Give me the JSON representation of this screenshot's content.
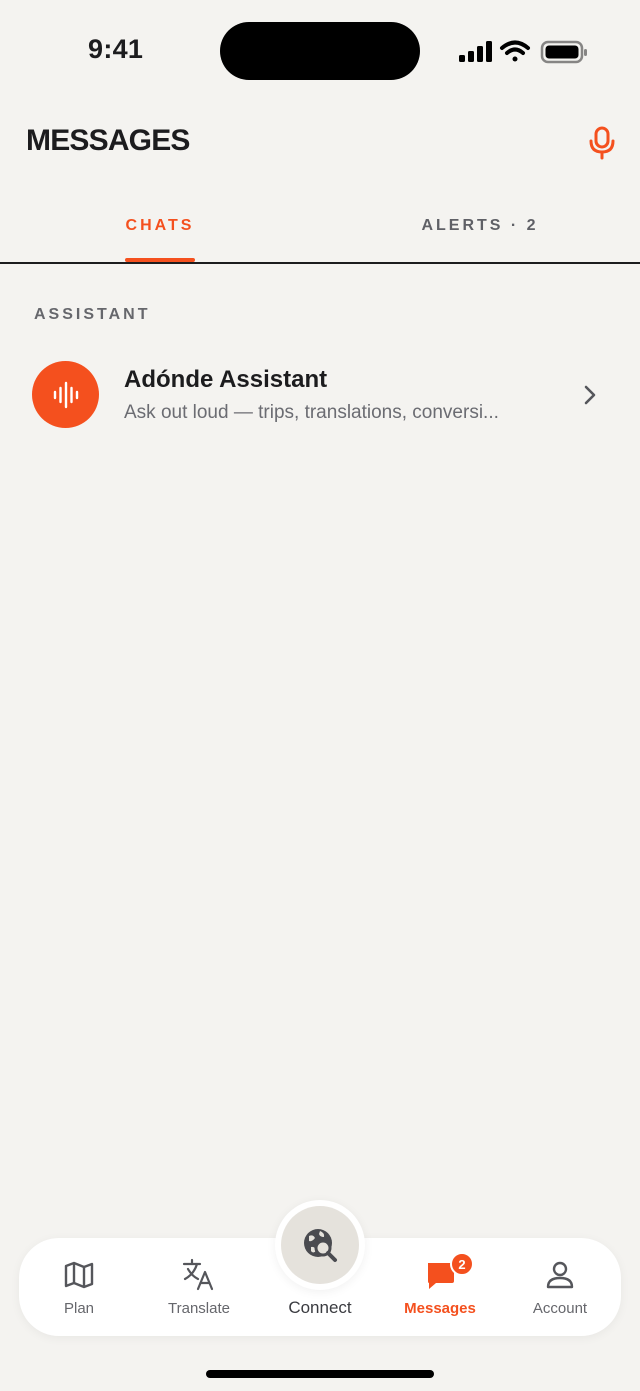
{
  "status_bar": {
    "time": "9:41"
  },
  "header": {
    "title": "MESSAGES",
    "mic_icon": "microphone-icon"
  },
  "tabs": [
    {
      "label": "CHATS",
      "active": true
    },
    {
      "label": "ALERTS · 2",
      "active": false
    }
  ],
  "section": {
    "label": "ASSISTANT"
  },
  "chat": {
    "name": "Adónde Assistant",
    "preview": "Ask out loud — trips, translations, conversi...",
    "avatar_icon": "audio-waveform-icon"
  },
  "nav": {
    "items": [
      {
        "label": "Plan",
        "icon": "map-icon"
      },
      {
        "label": "Translate",
        "icon": "translate-icon"
      },
      {
        "label": "Connect",
        "icon": "globe-search-icon"
      },
      {
        "label": "Messages",
        "icon": "chat-bubble-icon",
        "badge": "2",
        "active": true
      },
      {
        "label": "Account",
        "icon": "person-icon"
      }
    ]
  },
  "colors": {
    "accent": "#f4501e",
    "background": "#f4f3f0",
    "text": "#1c1c1e",
    "muted": "#66676c"
  }
}
